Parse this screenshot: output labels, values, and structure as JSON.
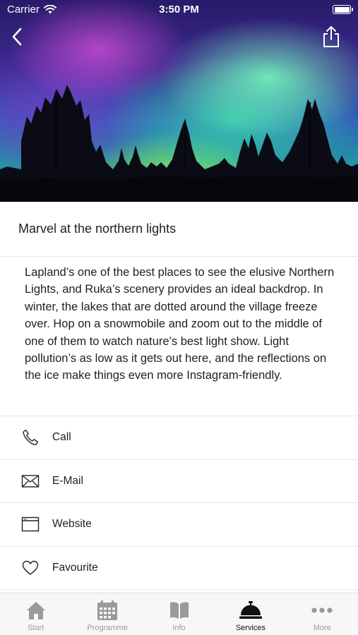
{
  "status_bar": {
    "carrier": "Carrier",
    "time": "3:50 PM"
  },
  "header": {
    "back_icon": "chevron-left-icon",
    "share_icon": "share-icon"
  },
  "article": {
    "title": "Marvel at the northern lights",
    "description": "Lapland’s one of the best places to see the elusive Northern Lights, and Ruka’s scenery provides an ideal backdrop. In winter, the lakes that are dotted around the village freeze over. Hop on a snowmobile and zoom out to the middle of one of them to watch nature’s best light show. Light pollution’s as low as it gets out here, and the reflections on the ice make things even more Instagram-friendly."
  },
  "actions": [
    {
      "label": "Call",
      "icon": "phone-icon"
    },
    {
      "label": "E-Mail",
      "icon": "mail-icon"
    },
    {
      "label": "Website",
      "icon": "browser-icon"
    },
    {
      "label": "Favourite",
      "icon": "heart-icon"
    }
  ],
  "tabbar": {
    "active": "Services",
    "tabs": [
      {
        "label": "Start",
        "icon": "home-icon"
      },
      {
        "label": "Programme",
        "icon": "calendar-icon"
      },
      {
        "label": "Info",
        "icon": "book-icon"
      },
      {
        "label": "Services",
        "icon": "service-bell-icon"
      },
      {
        "label": "More",
        "icon": "more-dots-icon"
      }
    ]
  },
  "colors": {
    "text": "#1f1f1f",
    "divider": "#e6e6e6",
    "tab_inactive": "#9a9a9a",
    "tab_active": "#111111"
  }
}
